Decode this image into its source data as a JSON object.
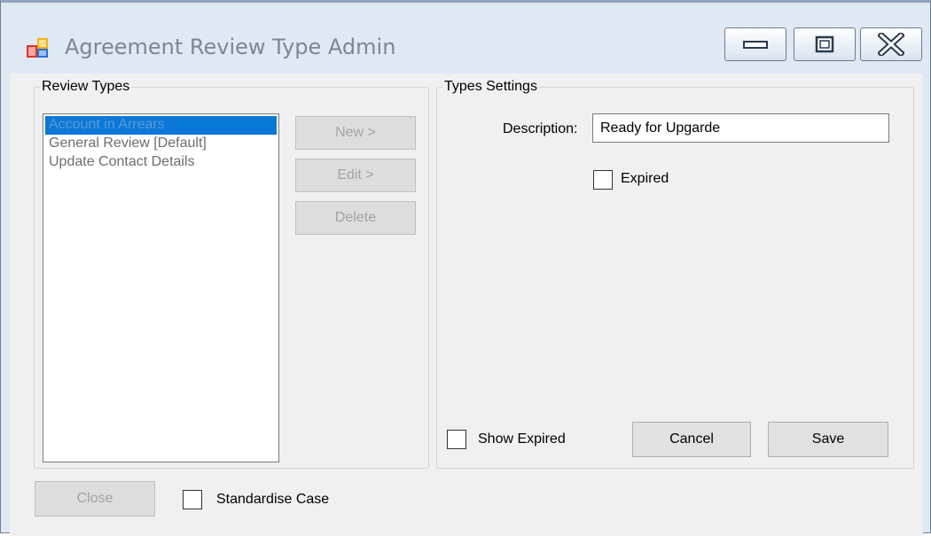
{
  "window": {
    "title": "Agreement Review Type Admin",
    "controls": [
      "minimize-icon",
      "maximize-icon",
      "close-icon"
    ]
  },
  "review_types": {
    "group_title": "Review Types",
    "items": [
      {
        "label": "Account in Arrears",
        "selected": true
      },
      {
        "label": "General Review [Default]",
        "selected": false
      },
      {
        "label": "Update Contact Details",
        "selected": false
      }
    ],
    "new_label": "New >",
    "edit_label": "Edit >",
    "delete_label": "Delete"
  },
  "types_settings": {
    "group_title": "Types Settings",
    "description_label": "Description:",
    "description_value": "Ready for Upgarde",
    "expired_label": "Expired",
    "expired_checked": false,
    "show_expired_label": "Show Expired",
    "show_expired_checked": false,
    "cancel_label": "Cancel",
    "save_label": "Save"
  },
  "footer": {
    "close_label": "Close",
    "standardise_case_label": "Standardise Case",
    "standardise_case_checked": false
  },
  "colors": {
    "selection": "#0a78d7",
    "window_frame": "#dfe8f3",
    "client_bg": "#f0f0f0"
  }
}
